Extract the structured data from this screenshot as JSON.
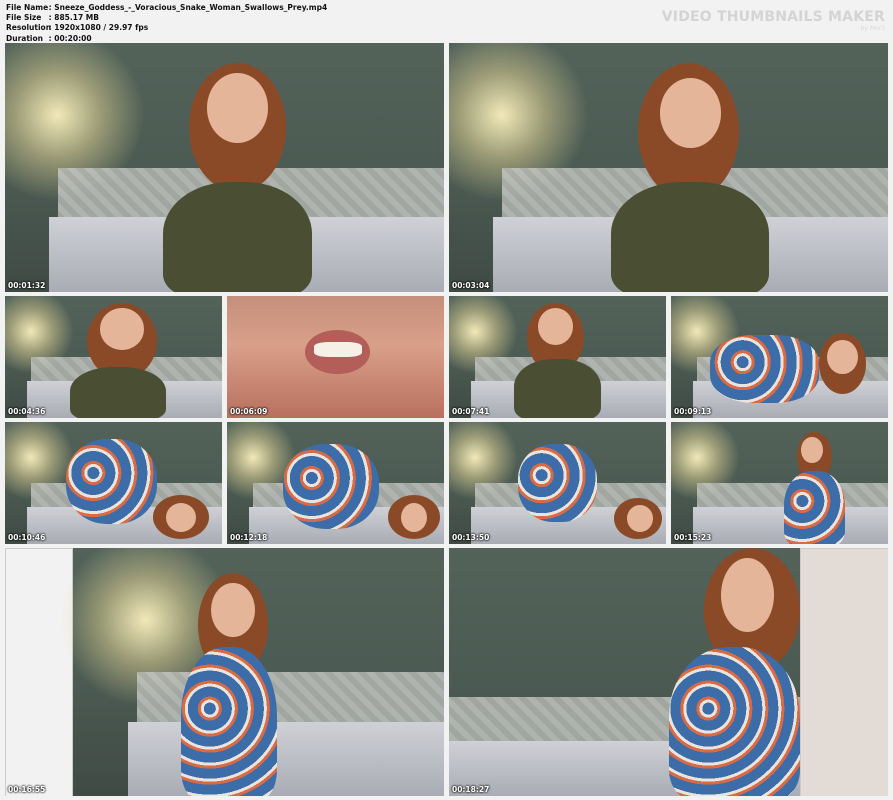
{
  "header": {
    "file_name_label": "File Name",
    "file_name_value": ": Sneeze_Goddess_-_Voracious_Snake_Woman_Swallows_Prey.mp4",
    "file_size_label": "File Size",
    "file_size_value": ": 885.17 MB",
    "resolution_label": "Resolution",
    "resolution_value": ": 1920x1080 / 29.97 fps",
    "duration_label": "Duration",
    "duration_value": ": 00:20:00",
    "watermark": "VIDEO THUMBNAILS MAKER",
    "watermark_sub": "by Mor3"
  },
  "thumbnails": [
    {
      "timestamp": "00:01:32"
    },
    {
      "timestamp": "00:03:04"
    },
    {
      "timestamp": "00:04:36"
    },
    {
      "timestamp": "00:06:09"
    },
    {
      "timestamp": "00:07:41"
    },
    {
      "timestamp": "00:09:13"
    },
    {
      "timestamp": "00:10:46"
    },
    {
      "timestamp": "00:12:18"
    },
    {
      "timestamp": "00:13:50"
    },
    {
      "timestamp": "00:15:23"
    },
    {
      "timestamp": "00:16:55"
    },
    {
      "timestamp": "00:18:27"
    }
  ]
}
